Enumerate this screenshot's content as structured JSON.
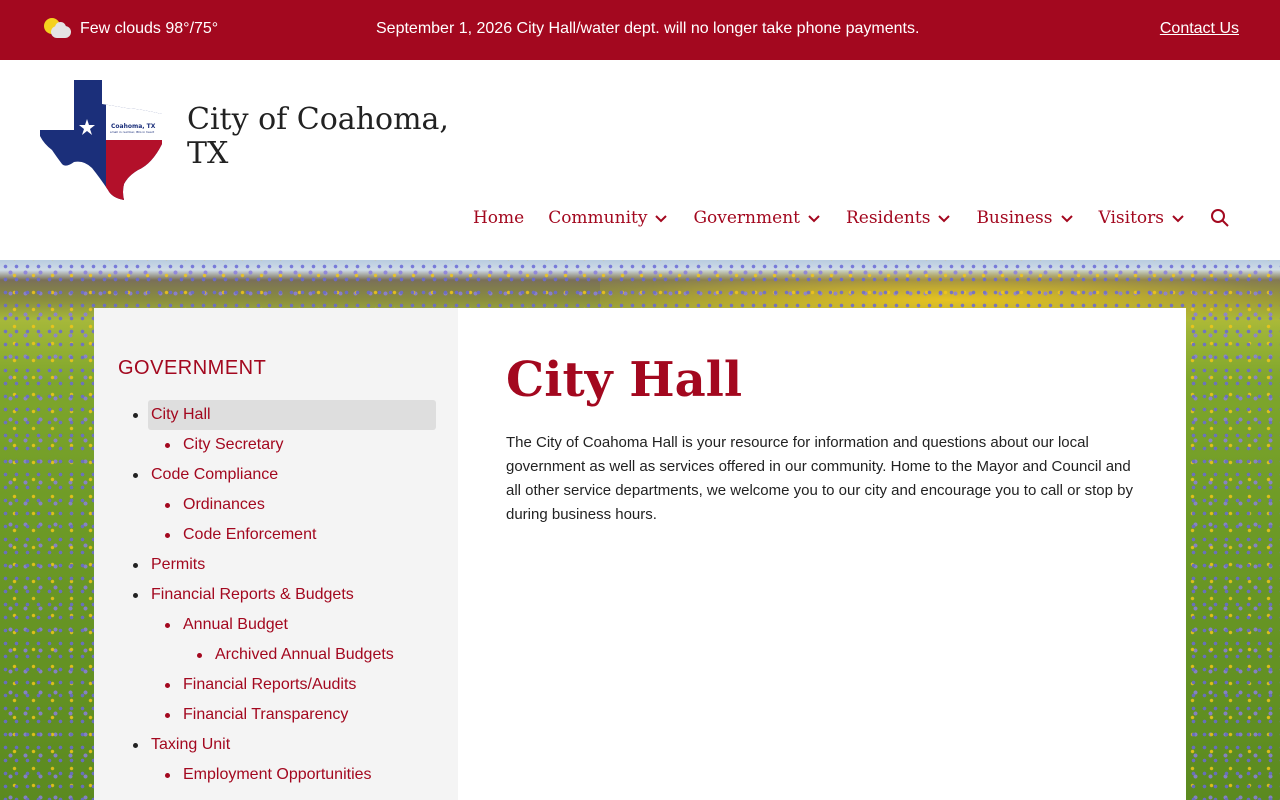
{
  "topbar": {
    "weather": "Few clouds 98°/75°",
    "weather_icon": "partly-cloudy-icon",
    "announcement": "September 1, 2026 City Hall/water dept. will no longer take phone payments.",
    "contact_label": "Contact Us"
  },
  "header": {
    "site_title": "City of Coahoma, TX",
    "logo_icon": "texas-flag-logo",
    "nav": [
      {
        "label": "Home",
        "has_dropdown": false
      },
      {
        "label": "Community",
        "has_dropdown": true
      },
      {
        "label": "Government",
        "has_dropdown": true
      },
      {
        "label": "Residents",
        "has_dropdown": true
      },
      {
        "label": "Business",
        "has_dropdown": true
      },
      {
        "label": "Visitors",
        "has_dropdown": true
      }
    ],
    "search_icon": "search-icon"
  },
  "sidebar": {
    "heading": "GOVERNMENT",
    "items": [
      {
        "label": "City Hall",
        "level": 1,
        "active": true
      },
      {
        "label": "City Secretary",
        "level": 2
      },
      {
        "label": "Code Compliance",
        "level": 1
      },
      {
        "label": "Ordinances",
        "level": 2
      },
      {
        "label": "Code Enforcement",
        "level": 2
      },
      {
        "label": "Permits",
        "level": 1
      },
      {
        "label": "Financial Reports & Budgets",
        "level": 1
      },
      {
        "label": "Annual Budget",
        "level": 2
      },
      {
        "label": "Archived Annual Budgets",
        "level": 3
      },
      {
        "label": "Financial Reports/Audits",
        "level": 2
      },
      {
        "label": "Financial Transparency",
        "level": 2
      },
      {
        "label": "Taxing Unit",
        "level": 1
      },
      {
        "label": "Employment Opportunities",
        "level": 2
      }
    ]
  },
  "main": {
    "title": "City Hall",
    "body": "The City of Coahoma Hall is your resource for information and questions about our local government as well as services offered in our community. Home to the Mayor and Council and all other service departments, we welcome you to our city and encourage you to call or stop by during business hours."
  },
  "colors": {
    "accent": "#a3081f",
    "sidebar_bg": "#f4f4f4",
    "active_bg": "#dedede"
  }
}
